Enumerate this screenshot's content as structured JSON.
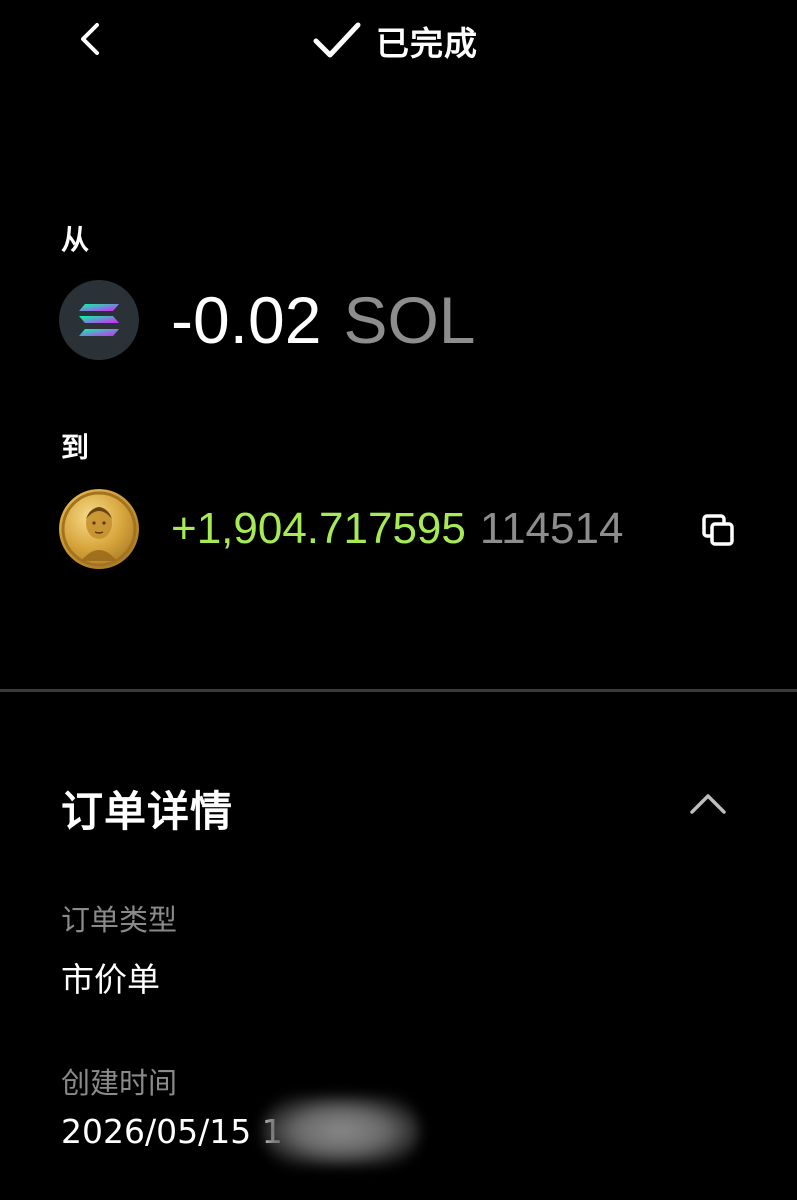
{
  "header": {
    "back_icon": "chevron-left-icon",
    "status_icon": "checkmark-icon",
    "status_text": "已完成"
  },
  "from": {
    "label": "从",
    "icon": "solana-coin-icon",
    "amount": "-0.02",
    "unit": "SOL"
  },
  "to": {
    "label": "到",
    "icon": "meme-coin-icon",
    "amount": "+1,904.717595",
    "unit": "114514",
    "copy_icon": "copy-icon",
    "amount_color": "#a6eb55"
  },
  "order_details": {
    "title": "订单详情",
    "collapse_icon": "chevron-up-icon",
    "fields": [
      {
        "label": "订单类型",
        "value": "市价单"
      },
      {
        "label": "创建时间",
        "value": "2026/05/15 1"
      }
    ]
  }
}
